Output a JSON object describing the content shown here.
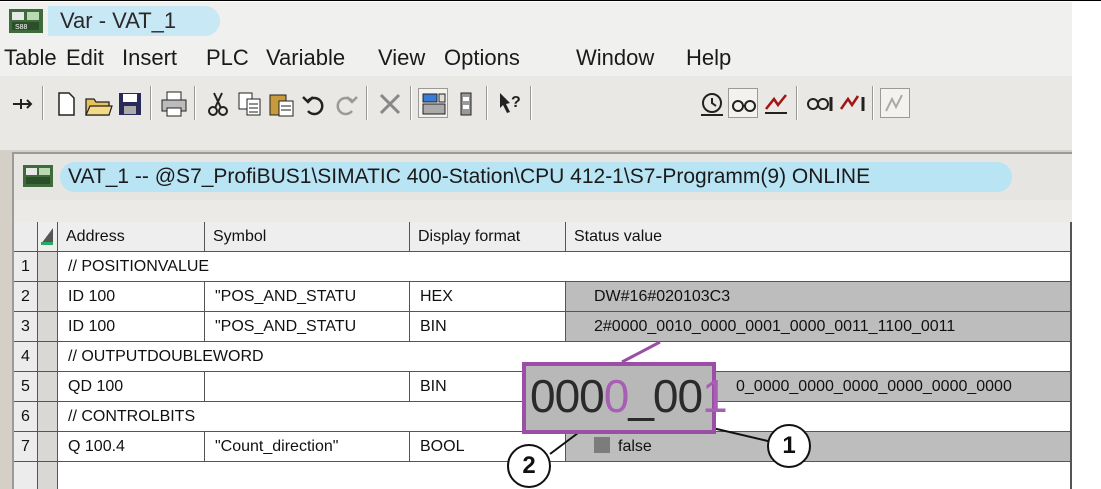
{
  "window": {
    "title": "Var - VAT_1"
  },
  "menu": [
    "Table",
    "Edit",
    "Insert",
    "PLC",
    "Variable",
    "View",
    "Options",
    "Window",
    "Help"
  ],
  "toolbar": {
    "icons": [
      "pin-icon",
      "new-icon",
      "open-icon",
      "save-icon",
      "print-icon",
      "cut-icon",
      "copy-icon",
      "paste-icon",
      "undo-icon",
      "redo-icon",
      "delete-icon",
      "online-icon",
      "monitor-icon",
      "help-context-icon",
      "trigger-icon",
      "monitor-variable-icon",
      "modify-variable-icon",
      "monitor-immediate-icon",
      "modify-immediate-icon",
      "force-icon"
    ]
  },
  "vat": {
    "title": "VAT_1 -- @S7_ProfiBUS1\\SIMATIC 400-Station\\CPU 412-1\\S7-Programm(9)  ONLINE",
    "columns": [
      "Address",
      "Symbol",
      "Display format",
      "Status value"
    ],
    "rows": [
      {
        "num": "1",
        "comment": "// POSITIONVALUE"
      },
      {
        "num": "2",
        "address": "ID  100",
        "symbol": "\"POS_AND_STATU",
        "format": "HEX",
        "status": "DW#16#020103C3"
      },
      {
        "num": "3",
        "address": "ID  100",
        "symbol": "\"POS_AND_STATU",
        "format": "BIN",
        "status": "2#0000_0010_0000_0001_0000_0011_1100_0011"
      },
      {
        "num": "4",
        "comment": "// OUTPUTDOUBLEWORD"
      },
      {
        "num": "5",
        "address": "QD  100",
        "symbol": "",
        "format": "BIN",
        "status": "0_0000_0000_0000_0000_0000_0000"
      },
      {
        "num": "6",
        "comment": "// CONTROLBITS"
      },
      {
        "num": "7",
        "address": "Q   100.4",
        "symbol": "\"Count_direction\"",
        "format": "BOOL",
        "status": "false"
      }
    ]
  },
  "annotation": {
    "zoom_a": "000",
    "zoom_b": "0",
    "zoom_c": "_00",
    "zoom_d": "1",
    "callout_1": "1",
    "callout_2": "2",
    "highlight_color": "#9b4ea6"
  }
}
